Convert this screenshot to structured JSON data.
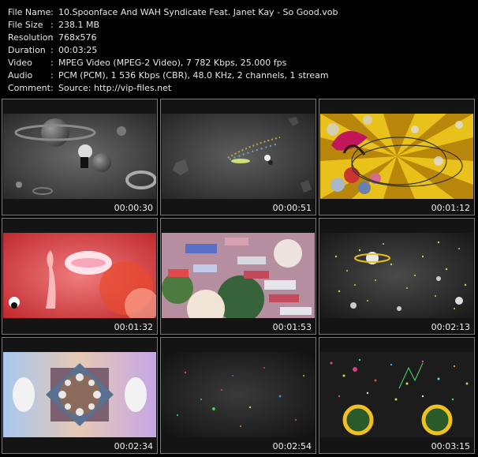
{
  "info": [
    {
      "key": "File Name",
      "sep": ":",
      "value": "10.Spoonface And WAH Syndicate Feat. Janet Kay - So Good.vob"
    },
    {
      "key": "File Size",
      "sep": ":",
      "value": "238.1 MB"
    },
    {
      "key": "Resolution",
      "sep": ":",
      "value": "768x576"
    },
    {
      "key": "Duration",
      "sep": ":",
      "value": "00:03:25"
    },
    {
      "key": "Video",
      "sep": ":",
      "value": "MPEG Video (MPEG-2 Video), 7 782 Kbps, 25.000 fps"
    },
    {
      "key": "Audio",
      "sep": ":",
      "value": "PCM (PCM), 1 536 Kbps (CBR), 48.0 KHz, 2 channels, 1 stream"
    },
    {
      "key": "Comment",
      "sep": ":",
      "value": "Source: http://vip-files.net"
    }
  ],
  "thumbnails": [
    {
      "time": "00:00:30",
      "scene": "gray-planets"
    },
    {
      "time": "00:00:51",
      "scene": "gray-comet"
    },
    {
      "time": "00:01:12",
      "scene": "yellow-mask"
    },
    {
      "time": "00:01:32",
      "scene": "red-lips"
    },
    {
      "time": "00:01:53",
      "scene": "blocks"
    },
    {
      "time": "00:02:13",
      "scene": "space-saturn"
    },
    {
      "time": "00:02:34",
      "scene": "kaleidoscope"
    },
    {
      "time": "00:02:54",
      "scene": "dark-dots"
    },
    {
      "time": "00:03:15",
      "scene": "rings-confetti"
    }
  ]
}
